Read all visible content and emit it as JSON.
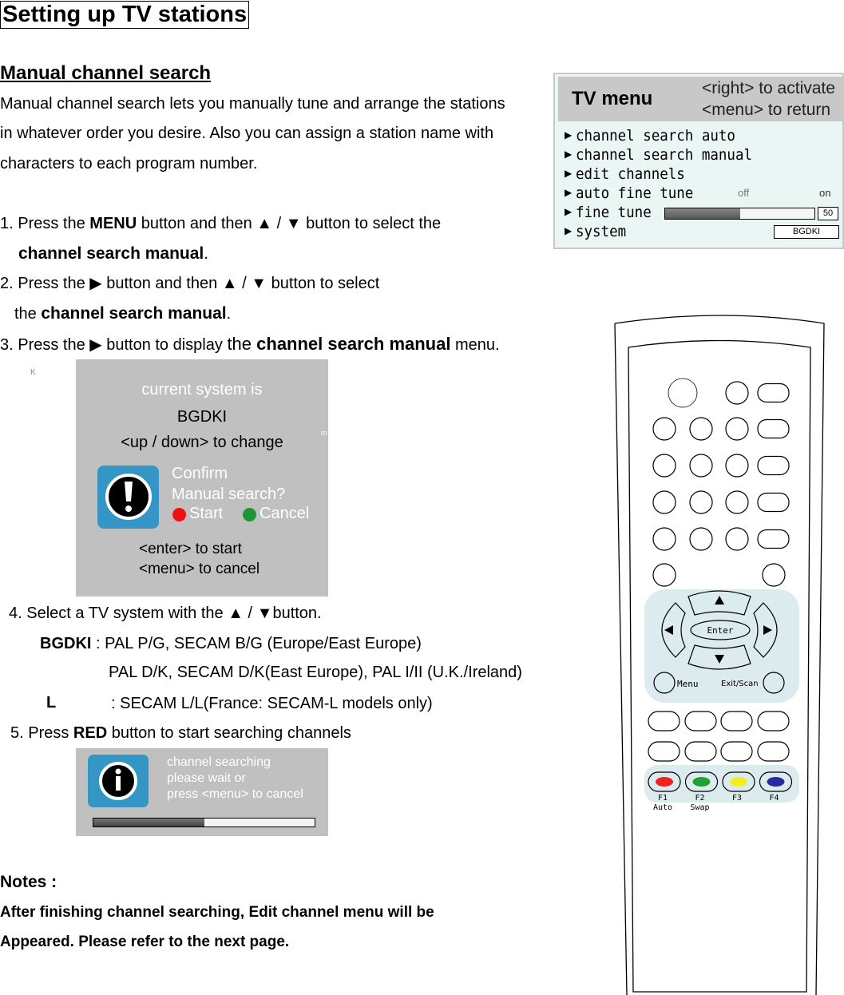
{
  "title": "Setting up TV stations",
  "section": "Manual channel search",
  "intro": [
    "Manual channel search lets you manually tune and arrange the stations",
    "in whatever order you desire. Also you can assign a station name with",
    "characters to each program number."
  ],
  "steps": {
    "s1a": "1. Press the ",
    "s1b": "MENU",
    "s1c": " button and then ▲ / ▼ button to select the",
    "s1d": "channel search manual",
    "s1e": ".",
    "s2a": "2. Press the ▶ button and then ▲ / ▼ button to select",
    "s2b": "the ",
    "s2c": "channel search manual",
    "s2d": ".",
    "s3a": "3. Press the ▶ button to display ",
    "s3b": "the ",
    "s3c": "channel search manual",
    "s3d": " menu.",
    "s4": "4. Select a TV system with the ▲ / ▼button.",
    "s4_bg_label": "BGDKI",
    "s4_bg_a": " : PAL P/G, SECAM B/G (Europe/East Europe)",
    "s4_bg_b": "PAL D/K, SECAM D/K(East Europe), PAL I/II (U.K./Ireland)",
    "s4_l_label": "L",
    "s4_l": ": SECAM L/L(France: SECAM-L models only)",
    "s5a": "5. Press ",
    "s5b": "RED",
    "s5c": " button to start searching channels"
  },
  "stray": {
    "k": "K",
    "m": "m"
  },
  "dialog1": {
    "line1": "current system is",
    "system": "BGDKI",
    "change": "<up / down> to change",
    "confirm": "Confirm",
    "question": "Manual search?",
    "start": "Start",
    "cancel": "Cancel",
    "enter": "<enter> to start",
    "menu": "<menu> to cancel",
    "icon": "exclamation-icon",
    "start_color": "#ee1111",
    "cancel_color": "#1a9633"
  },
  "dialog2": {
    "lines": [
      "channel searching",
      "please wait or",
      "press <menu> to cancel"
    ],
    "icon": "info-icon",
    "progress_percent": 50
  },
  "tv_menu": {
    "title": "TV menu",
    "hint1": "<right> to activate",
    "hint2": "<menu> to return",
    "items": [
      "channel search auto",
      "channel search manual",
      "edit channels",
      "auto fine tune",
      "fine tune",
      "system"
    ],
    "auto_fine_tune": {
      "off": "off",
      "on": "on"
    },
    "fine_tune": {
      "value": "50",
      "percent": 50
    },
    "system_value": "BGDKI"
  },
  "remote": {
    "enter": "Enter",
    "menu": "Menu",
    "exit": "Exit/Scan",
    "f_keys": [
      {
        "label": "F1",
        "sub": "Auto",
        "color": "#ee2222"
      },
      {
        "label": "F2",
        "sub": "Swap",
        "color": "#22a033"
      },
      {
        "label": "F3",
        "sub": "",
        "color": "#f0f020"
      },
      {
        "label": "F4",
        "sub": "",
        "color": "#2a2aa0"
      }
    ],
    "panel_color": "#dcecee"
  },
  "notes": {
    "heading": "Notes :",
    "line1": "After finishing channel searching, Edit channel menu will be",
    "line2": "Appeared. Please refer to the next page."
  }
}
